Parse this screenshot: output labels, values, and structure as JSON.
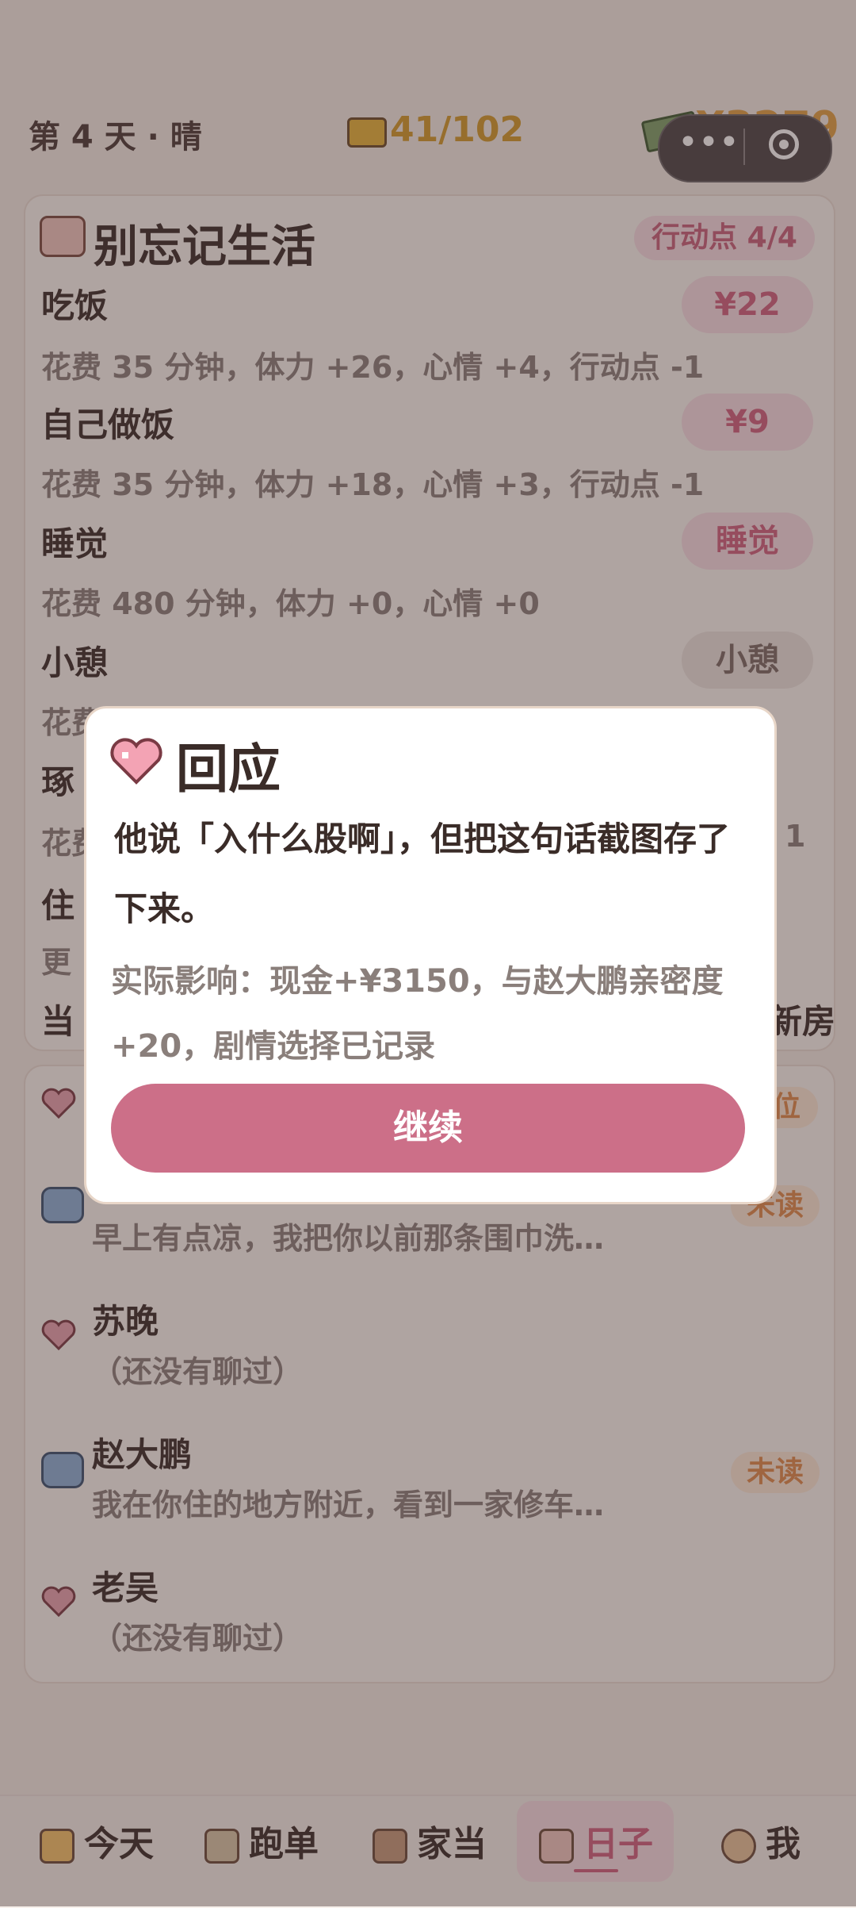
{
  "status": {
    "day": "第 4 天 · 晴",
    "energy": "41/102",
    "money": "¥3279"
  },
  "life_card": {
    "title": "别忘记生活",
    "action_points": "行动点 4/4",
    "activities": [
      {
        "name": "吃饭",
        "desc": "花费 35 分钟，体力 +26，心情 +4，行动点 -1",
        "button": "¥22"
      },
      {
        "name": "自己做饭",
        "desc": "花费 35 分钟，体力 +18，心情 +3，行动点 -1",
        "button": "¥9"
      },
      {
        "name": "睡觉",
        "desc": "花费 480 分钟，体力 +0，心情 +0",
        "button": "睡觉"
      },
      {
        "name": "小憩",
        "desc": "花费",
        "button": "小憩"
      }
    ],
    "partial_rows": [
      "琢",
      "花费",
      "住",
      "更",
      "当"
    ],
    "partial_right": [
      "1",
      "新房"
    ]
  },
  "messages": {
    "top_right_badge": "位",
    "items": [
      {
        "name": "",
        "text": "早上有点凉，我把你以前那条围巾洗…",
        "badge": "未读",
        "icon": "chat-icon"
      },
      {
        "name": "苏晚",
        "text": "（还没有聊过）",
        "badge": "",
        "icon": "heart-icon"
      },
      {
        "name": "赵大鹏",
        "text": "我在你住的地方附近，看到一家修车…",
        "badge": "未读",
        "icon": "chat-icon"
      },
      {
        "name": "老吴",
        "text": "（还没有聊过）",
        "badge": "",
        "icon": "heart-icon"
      }
    ]
  },
  "nav": {
    "today": "今天",
    "orders": "跑单",
    "assets": "家当",
    "days": "日子",
    "me": "我"
  },
  "modal": {
    "title": "回应",
    "body": "他说「入什么股啊」，但把这句话截图存了下来。",
    "effect": "实际影响：现金+¥3150，与赵大鹏亲密度+20，剧情选择已记录",
    "button": "继续"
  }
}
